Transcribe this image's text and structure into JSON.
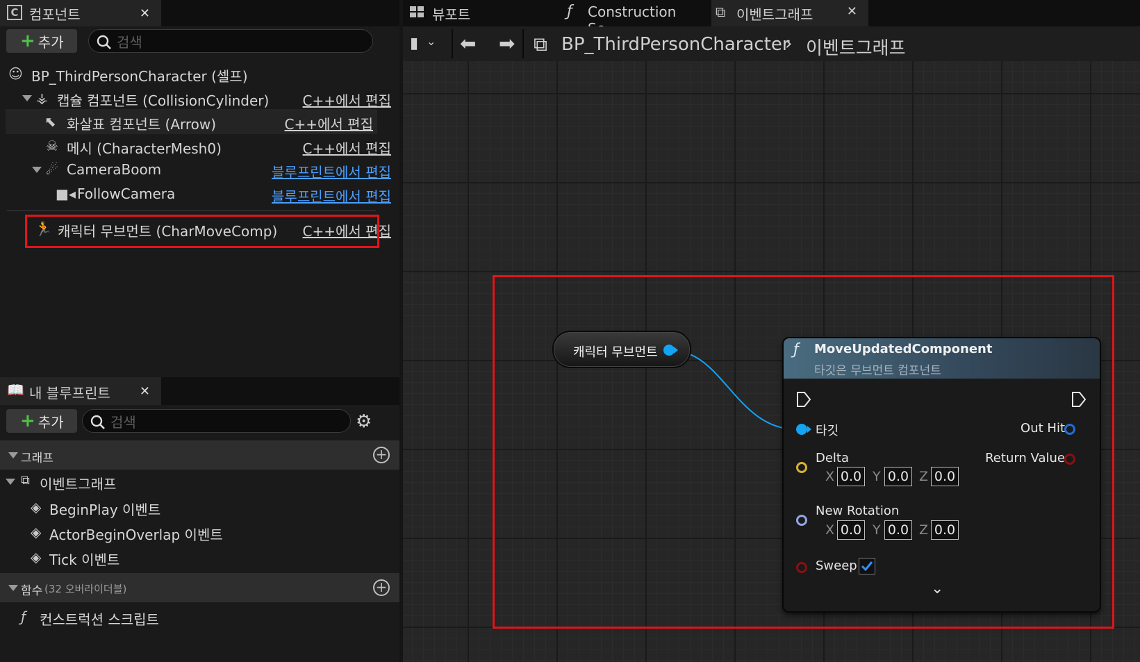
{
  "components": {
    "tab_title": "컴포넌트",
    "add_label": "추가",
    "search_placeholder": "검색",
    "root": "BP_ThirdPersonCharacter (셀프)",
    "items": [
      {
        "label": "캡슐 컴포넌트 (CollisionCylinder)",
        "edit": "C++에서 편집"
      },
      {
        "label": "화살표 컴포넌트 (Arrow)",
        "edit": "C++에서 편집"
      },
      {
        "label": "메시 (CharacterMesh0)",
        "edit": "C++에서 편집"
      },
      {
        "label": "CameraBoom",
        "edit": "블루프린트에서 편집"
      },
      {
        "label": "FollowCamera",
        "edit": "블루프린트에서 편집"
      },
      {
        "label": "캐릭터 무브먼트 (CharMoveComp)",
        "edit": "C++에서 편집"
      }
    ]
  },
  "my_blueprint": {
    "tab_title": "내 블루프린트",
    "add_label": "추가",
    "search_placeholder": "검색",
    "graph_section": "그래프",
    "event_graph": "이벤트그래프",
    "events": [
      "BeginPlay 이벤트",
      "ActorBeginOverlap 이벤트",
      "Tick 이벤트"
    ],
    "functions_section": "함수",
    "functions_count": "(32 오버라이더블)",
    "construction_script": "컨스트럭션 스크립트"
  },
  "editor_tabs": [
    {
      "label": "뷰포트"
    },
    {
      "label": "Construction Sc..."
    },
    {
      "label": "이벤트그래프"
    }
  ],
  "breadcrumb": {
    "blueprint": "BP_ThirdPersonCharacter",
    "graph": "이벤트그래프"
  },
  "graph": {
    "var_node_label": "캐릭터 무브먼트",
    "fn_node": {
      "title": "MoveUpdatedComponent",
      "subtitle": "타깃은 무브먼트 컴포넌트",
      "target": "타깃",
      "out_hit": "Out Hit",
      "delta": "Delta",
      "return_value": "Return Value",
      "new_rotation": "New Rotation",
      "sweep": "Sweep",
      "axis_x": "X",
      "axis_y": "Y",
      "axis_z": "Z",
      "delta_values": [
        "0.0",
        "0.0",
        "0.0"
      ],
      "rotation_values": [
        "0.0",
        "0.0",
        "0.0"
      ]
    }
  },
  "colors": {
    "highlight": "#e0141a",
    "object_pin": "#12a4f5",
    "link": "#4a9eff",
    "exec_pin": "#e8e8e8"
  }
}
